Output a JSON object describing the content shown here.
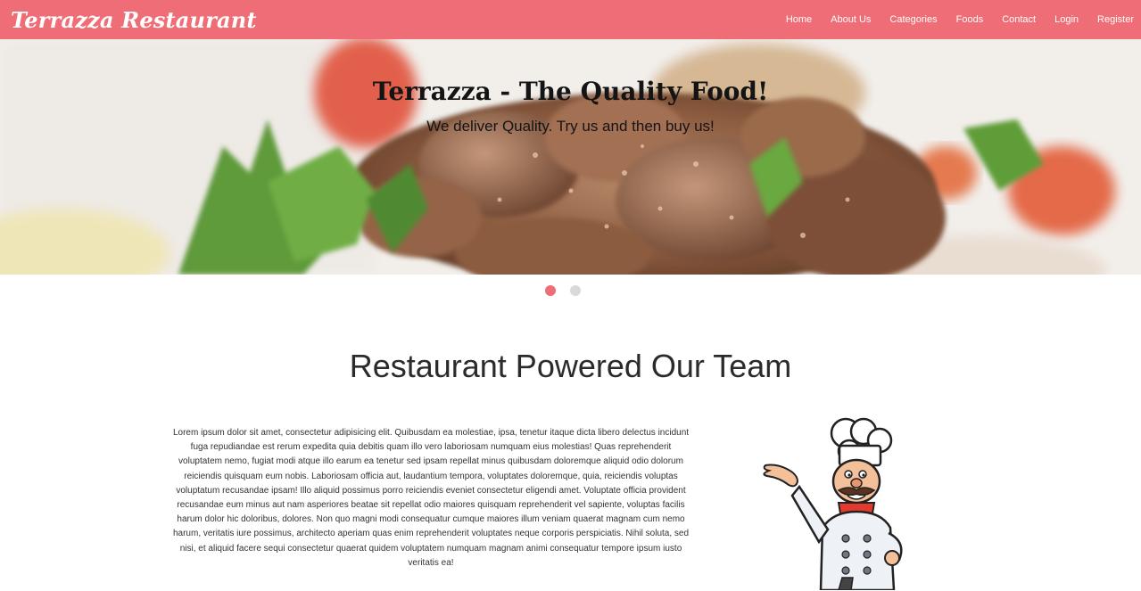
{
  "navbar": {
    "brand": "Terrazza Restaurant",
    "links": [
      "Home",
      "About Us",
      "Categories",
      "Foods",
      "Contact",
      "Login",
      "Register"
    ]
  },
  "hero": {
    "title": "Terrazza - The Quality Food!",
    "subtitle": "We deliver Quality. Try us and then buy us!",
    "active_slide": 1,
    "slide_count": 2
  },
  "section": {
    "title": "Restaurant Powered Our Team",
    "body": "Lorem ipsum dolor sit amet, consectetur adipisicing elit. Quibusdam ea molestiae, ipsa, tenetur itaque dicta libero delectus incidunt fuga repudiandae est rerum expedita quia debitis quam illo vero laboriosam numquam eius molestias! Quas reprehenderit voluptatem nemo, fugiat modi atque illo earum ea tenetur sed ipsam repellat minus quibusdam doloremque aliquid odio dolorum reiciendis quisquam eum nobis. Laboriosam officia aut, laudantium tempora, voluptates doloremque, quia, reiciendis voluptas voluptatum recusandae ipsam! Illo aliquid possimus porro reiciendis eveniet consectetur eligendi amet. Voluptate officia provident recusandae eum minus aut nam asperiores beatae sit repellat odio maiores quisquam reprehenderit vel sapiente, voluptas facilis harum dolor hic doloribus, dolores. Non quo magni modi consequatur cumque maiores illum veniam quaerat magnam cum nemo harum, veritatis iure possimus, architecto aperiam quas enim reprehenderit voluptates neque corporis perspiciatis. Nihil soluta, sed nisi, et aliquid facere sequi consectetur quaerat quidem voluptatem numquam magnam animi consequatur tempore ipsum iusto veritatis ea!"
  },
  "colors": {
    "accent": "#ef6d76",
    "dot_inactive": "#d9d9d9"
  },
  "icons": {
    "chef": "chef-illustration"
  }
}
